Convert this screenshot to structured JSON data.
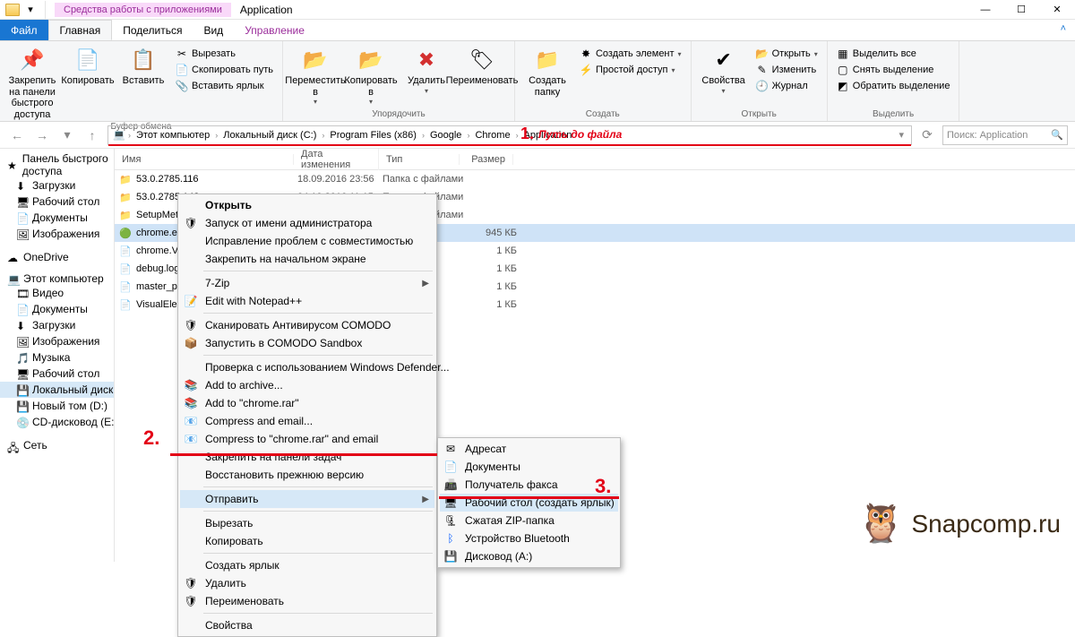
{
  "window": {
    "contextual_tab": "Средства работы с приложениями",
    "title": "Application",
    "controls": {
      "min": "—",
      "max": "☐",
      "close": "✕"
    }
  },
  "tabs": {
    "file": "Файл",
    "home": "Главная",
    "share": "Поделиться",
    "view": "Вид",
    "manage": "Управление"
  },
  "ribbon": {
    "clipboard": {
      "label": "Буфер обмена",
      "pin": "Закрепить на панели быстрого доступа",
      "copy": "Копировать",
      "paste": "Вставить",
      "cut": "Вырезать",
      "copy_path": "Скопировать путь",
      "paste_shortcut": "Вставить ярлык"
    },
    "organize": {
      "label": "Упорядочить",
      "move": "Переместить в",
      "copy_to": "Копировать в",
      "delete": "Удалить",
      "rename": "Переименовать"
    },
    "new": {
      "label": "Создать",
      "new_folder": "Создать папку",
      "new_item": "Создать элемент",
      "easy_access": "Простой доступ"
    },
    "open": {
      "label": "Открыть",
      "properties": "Свойства",
      "open": "Открыть",
      "edit": "Изменить",
      "history": "Журнал"
    },
    "select": {
      "label": "Выделить",
      "all": "Выделить все",
      "none": "Снять выделение",
      "invert": "Обратить выделение"
    }
  },
  "breadcrumb": [
    "Этот компьютер",
    "Локальный диск (C:)",
    "Program Files (x86)",
    "Google",
    "Chrome",
    "Application"
  ],
  "search": {
    "placeholder": "Поиск: Application"
  },
  "annotations": {
    "n1": "1.",
    "n1_label": "Путь до файла",
    "n2": "2.",
    "n3": "3."
  },
  "sidebar": {
    "quick": {
      "head": "Панель быстрого доступа",
      "items": [
        "Загрузки",
        "Рабочий стол",
        "Документы",
        "Изображения"
      ]
    },
    "onedrive": "OneDrive",
    "this_pc": {
      "head": "Этот компьютер",
      "items": [
        "Видео",
        "Документы",
        "Загрузки",
        "Изображения",
        "Музыка",
        "Рабочий стол",
        "Локальный диск (C:)",
        "Новый том (D:)",
        "CD-дисковод (E:)"
      ]
    },
    "network": "Сеть"
  },
  "columns": {
    "name": "Имя",
    "date": "Дата изменения",
    "type": "Тип",
    "size": "Размер"
  },
  "files": [
    {
      "name": "53.0.2785.116",
      "date": "18.09.2016 23:56",
      "type": "Папка с файлами",
      "size": "",
      "icon": "folder"
    },
    {
      "name": "53.0.2785.143",
      "date": "04.10.2016 11:15",
      "type": "Папка с файлами",
      "size": "",
      "icon": "folder"
    },
    {
      "name": "SetupMetrics",
      "date": "04.10.2016 11:15",
      "type": "Папка с файлами",
      "size": "",
      "icon": "folder"
    },
    {
      "name": "chrome.exe",
      "date": "",
      "type": "",
      "size": "945 КБ",
      "icon": "chrome",
      "selected": true
    },
    {
      "name": "chrome.VisualElementsManifest",
      "date": "",
      "type": "",
      "size": "1 КБ",
      "icon": "file"
    },
    {
      "name": "debug.log",
      "date": "",
      "type": "",
      "size": "1 КБ",
      "icon": "file"
    },
    {
      "name": "master_preferences",
      "date": "",
      "type": "",
      "size": "1 КБ",
      "icon": "file"
    },
    {
      "name": "VisualElementsManifest",
      "date": "",
      "type": "",
      "size": "1 КБ",
      "icon": "file"
    }
  ],
  "ctx": {
    "open": "Открыть",
    "run_admin": "Запуск от имени администратора",
    "compat": "Исправление проблем с совместимостью",
    "pin_start": "Закрепить на начальном экране",
    "sevenzip": "7-Zip",
    "notepadpp": "Edit with Notepad++",
    "comodo_scan": "Сканировать Антивирусом COMODO",
    "comodo_sandbox": "Запустить в COMODO Sandbox",
    "defender": "Проверка с использованием Windows Defender...",
    "add_archive": "Add to archive...",
    "add_chrome_rar": "Add to \"chrome.rar\"",
    "compress_email": "Compress and email...",
    "compress_chrome_email": "Compress to \"chrome.rar\" and email",
    "pin_taskbar": "Закрепить на панели задач",
    "restore": "Восстановить прежнюю версию",
    "send": "Отправить",
    "cut": "Вырезать",
    "copy": "Копировать",
    "create_shortcut": "Создать ярлык",
    "delete": "Удалить",
    "rename": "Переименовать",
    "properties": "Свойства"
  },
  "submenu": {
    "addressee": "Адресат",
    "documents": "Документы",
    "fax": "Получатель факса",
    "desktop_link": "Рабочий стол (создать ярлык)",
    "zip": "Сжатая ZIP-папка",
    "bluetooth": "Устройство Bluetooth",
    "drive_a": "Дисковод (A:)"
  },
  "brand": "Snapcomp.ru"
}
